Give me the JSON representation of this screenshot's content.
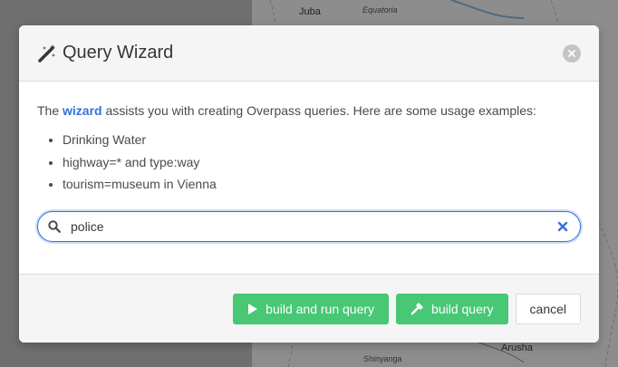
{
  "map": {
    "labels": [
      "Juba",
      "Equatoria",
      "Arusha",
      "Shinyanga"
    ]
  },
  "dialog": {
    "title": "Query Wizard",
    "title_icon": "magic-wand-icon",
    "close_icon": "close-icon",
    "intro_prefix": "The",
    "intro_link": "wizard",
    "intro_suffix": "assists you with creating Overpass queries. Here are some usage examples:",
    "examples": [
      "Drinking Water",
      "highway=* and type:way",
      "tourism=museum in Vienna"
    ],
    "search": {
      "value": "police",
      "icon": "search-icon",
      "clear_icon": "clear-icon"
    },
    "buttons": {
      "build_and_run": "build and run query",
      "build": "build query",
      "cancel": "cancel"
    }
  },
  "colors": {
    "accent": "#3273dc",
    "success": "#48c774",
    "header_bg": "#f5f5f5"
  }
}
